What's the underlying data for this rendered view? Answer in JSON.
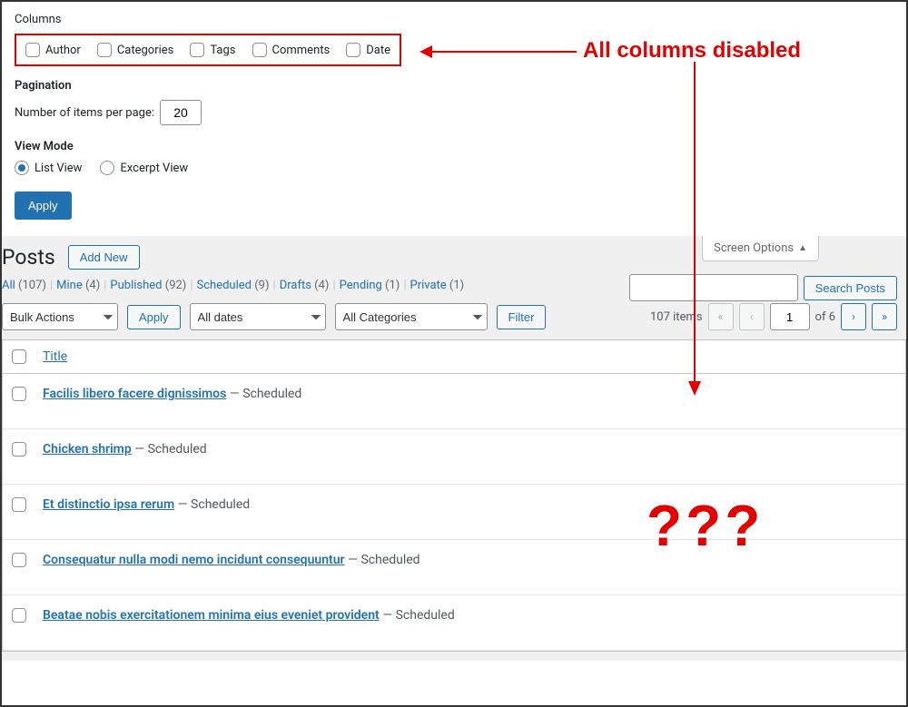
{
  "screenOptions": {
    "columnsLabel": "Columns",
    "columnCheckboxes": [
      "Author",
      "Categories",
      "Tags",
      "Comments",
      "Date"
    ],
    "paginationLabel": "Pagination",
    "itemsPerPageLabel": "Number of items per page:",
    "itemsPerPageValue": "20",
    "viewModeLabel": "View Mode",
    "viewModes": [
      "List View",
      "Excerpt View"
    ],
    "applyLabel": "Apply",
    "tabLabel": "Screen Options"
  },
  "page": {
    "title": "Posts",
    "addNewLabel": "Add New"
  },
  "filters": [
    {
      "label": "All",
      "count": "107"
    },
    {
      "label": "Mine",
      "count": "4"
    },
    {
      "label": "Published",
      "count": "92"
    },
    {
      "label": "Scheduled",
      "count": "9"
    },
    {
      "label": "Drafts",
      "count": "4"
    },
    {
      "label": "Pending",
      "count": "1"
    },
    {
      "label": "Private",
      "count": "1"
    }
  ],
  "search": {
    "buttonLabel": "Search Posts"
  },
  "toolbar": {
    "bulkActions": "Bulk Actions",
    "apply": "Apply",
    "allDates": "All dates",
    "allCategories": "All Categories",
    "filter": "Filter"
  },
  "pager": {
    "itemsText": "107 items",
    "page": "1",
    "ofText": "of 6"
  },
  "table": {
    "titleHeader": "Title",
    "rows": [
      {
        "title": "Facilis libero facere dignissimos",
        "status": "Scheduled"
      },
      {
        "title": "Chicken shrimp",
        "status": "Scheduled"
      },
      {
        "title": "Et distinctio ipsa rerum",
        "status": "Scheduled"
      },
      {
        "title": "Consequatur nulla modi nemo incidunt consequuntur",
        "status": "Scheduled"
      },
      {
        "title": "Beatae nobis exercitationem minima eius eveniet provident",
        "status": "Scheduled"
      }
    ]
  },
  "annotations": {
    "disabledLabel": "All columns disabled",
    "question": "???"
  }
}
